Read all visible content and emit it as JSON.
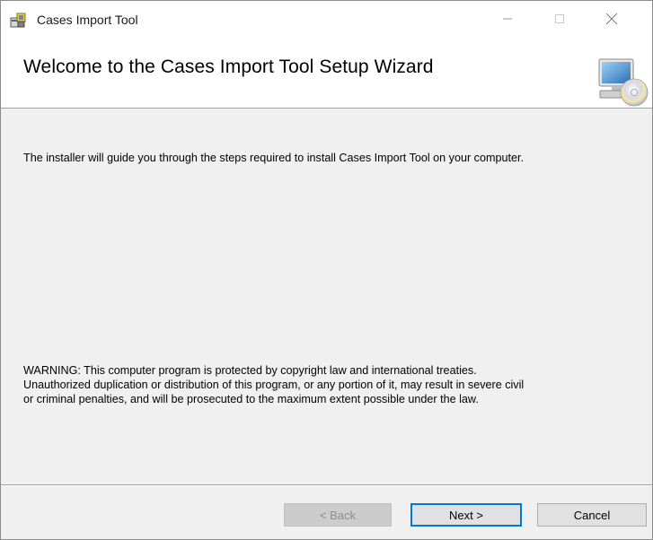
{
  "window": {
    "title": "Cases Import Tool",
    "controls": {
      "minimize": "—",
      "maximize": "☐",
      "close": "✕"
    },
    "icons": {
      "app": "installer-app-icon",
      "header": "computer-cd-icon"
    }
  },
  "header": {
    "title": "Welcome to the Cases Import Tool Setup Wizard"
  },
  "content": {
    "intro": "The installer will guide you through the steps required to install Cases Import Tool on your computer.",
    "warning_lines": [
      "WARNING: This computer program is protected by copyright law and international treaties.",
      "Unauthorized duplication or distribution of this program, or any portion of it, may result in severe civil",
      "or criminal penalties, and will be prosecuted to the maximum extent possible under the law."
    ]
  },
  "buttons": {
    "back": "< Back",
    "next": "Next >",
    "cancel": "Cancel"
  },
  "colors": {
    "focus_border": "#0078d7",
    "window_bg": "#f0f0f0"
  }
}
